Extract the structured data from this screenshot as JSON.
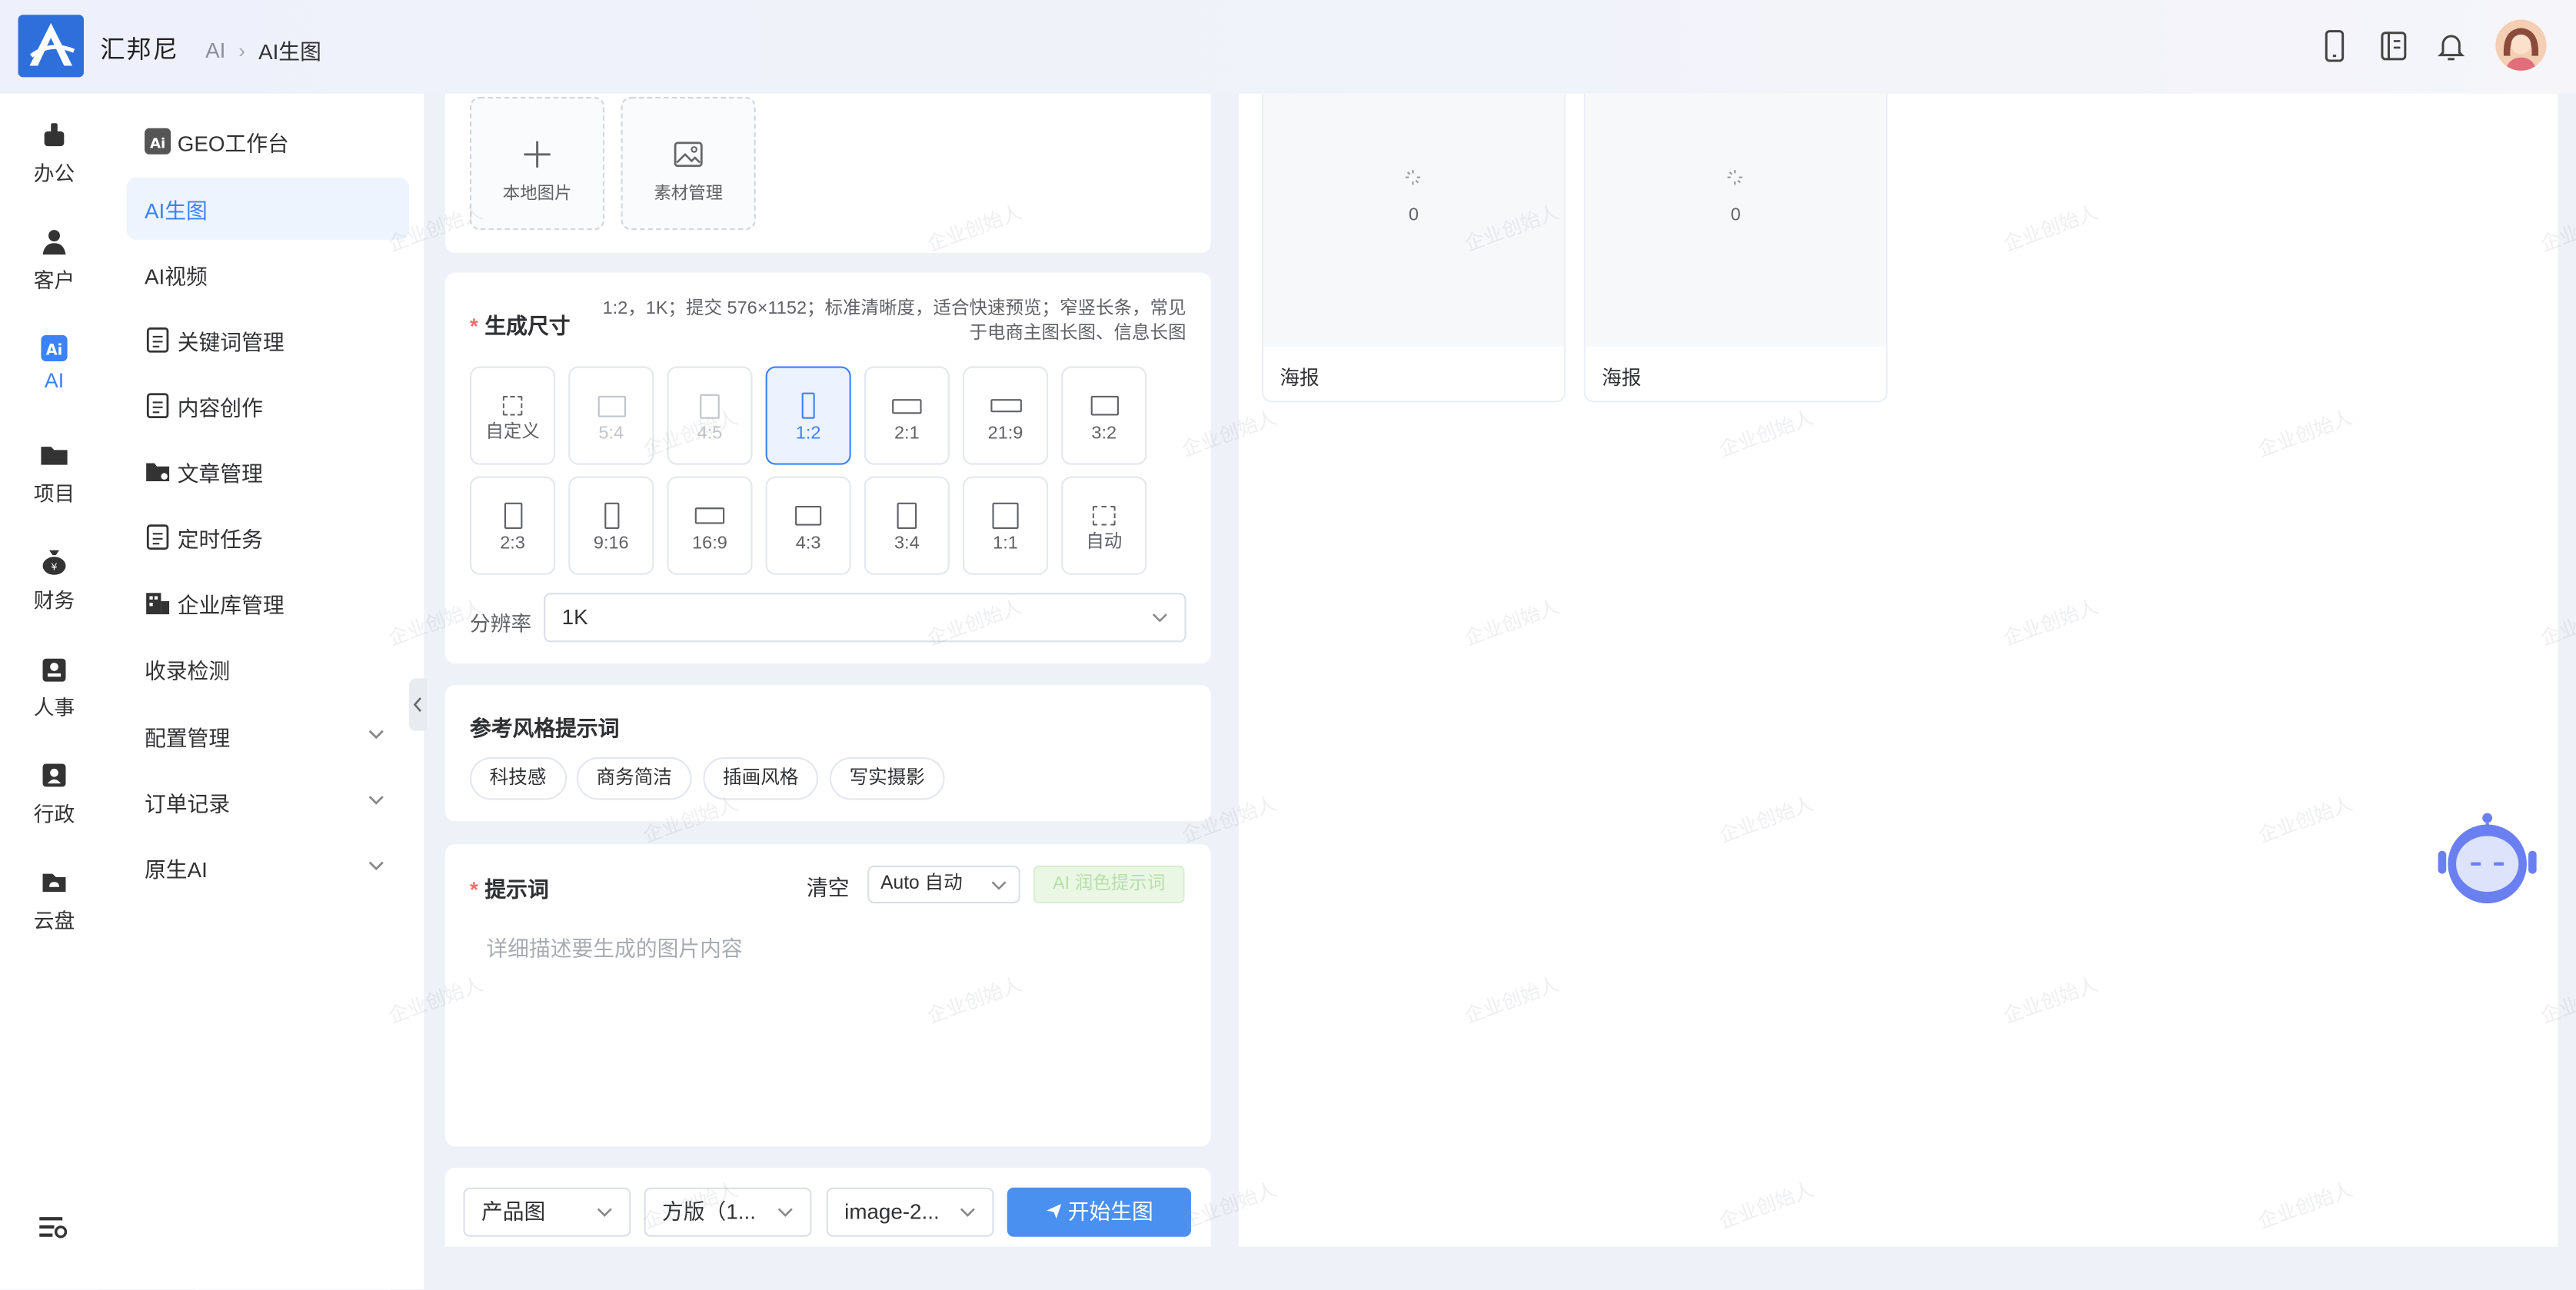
{
  "header": {
    "brand": "汇邦尼",
    "breadcrumb": [
      "AI",
      "AI生图"
    ]
  },
  "rail": [
    {
      "label": "办公",
      "icon": "office-icon"
    },
    {
      "label": "客户",
      "icon": "customer-icon"
    },
    {
      "label": "AI",
      "icon": "ai-icon",
      "active": true
    },
    {
      "label": "项目",
      "icon": "project-folder-icon"
    },
    {
      "label": "财务",
      "icon": "finance-bag-icon"
    },
    {
      "label": "人事",
      "icon": "hr-badge-icon"
    },
    {
      "label": "行政",
      "icon": "admin-id-icon"
    },
    {
      "label": "云盘",
      "icon": "cloud-disk-icon"
    }
  ],
  "nav": {
    "workbench": "GEO工作台",
    "items": [
      {
        "label": "AI生图",
        "active": true
      },
      {
        "label": "AI视频"
      },
      {
        "label": "关键词管理"
      },
      {
        "label": "内容创作"
      },
      {
        "label": "文章管理"
      },
      {
        "label": "定时任务"
      },
      {
        "label": "企业库管理"
      },
      {
        "label": "收录检测"
      },
      {
        "label": "配置管理"
      },
      {
        "label": "订单记录"
      },
      {
        "label": "原生AI"
      }
    ]
  },
  "upload": {
    "local": "本地图片",
    "material": "素材管理"
  },
  "size": {
    "title": "生成尺寸",
    "hint": "1:2，1K；提交 576×1152；标准清晰度，适合快速预览；窄竖长条，常见于电商主图长图、信息长图",
    "ratios": [
      {
        "label": "自定义",
        "state": "normal"
      },
      {
        "label": "5:4",
        "state": "disabled"
      },
      {
        "label": "4:5",
        "state": "disabled"
      },
      {
        "label": "1:2",
        "state": "selected"
      },
      {
        "label": "2:1",
        "state": "normal"
      },
      {
        "label": "21:9",
        "state": "normal"
      },
      {
        "label": "3:2",
        "state": "normal"
      },
      {
        "label": "2:3",
        "state": "normal"
      },
      {
        "label": "9:16",
        "state": "normal"
      },
      {
        "label": "16:9",
        "state": "normal"
      },
      {
        "label": "4:3",
        "state": "normal"
      },
      {
        "label": "3:4",
        "state": "normal"
      },
      {
        "label": "1:1",
        "state": "normal"
      },
      {
        "label": "自动",
        "state": "normal"
      }
    ],
    "resolution_label": "分辨率",
    "resolution_value": "1K"
  },
  "style": {
    "title": "参考风格提示词",
    "tags": [
      "科技感",
      "商务简洁",
      "插画风格",
      "写实摄影"
    ]
  },
  "prompt": {
    "title": "提示词",
    "clear": "清空",
    "mode": "Auto 自动",
    "polish": "AI 润色提示词",
    "placeholder": "详细描述要生成的图片内容"
  },
  "footer": {
    "type": "产品图",
    "format": "方版（1...",
    "model": "image-2...",
    "submit": "开始生图"
  },
  "results": [
    {
      "count": "0",
      "caption": "海报"
    },
    {
      "count": "0",
      "caption": "海报"
    }
  ],
  "watermark": "企业创始人",
  "colors": {
    "accent": "#3a82f6",
    "brand": "#2f6fdc",
    "required": "#f56c6c"
  }
}
